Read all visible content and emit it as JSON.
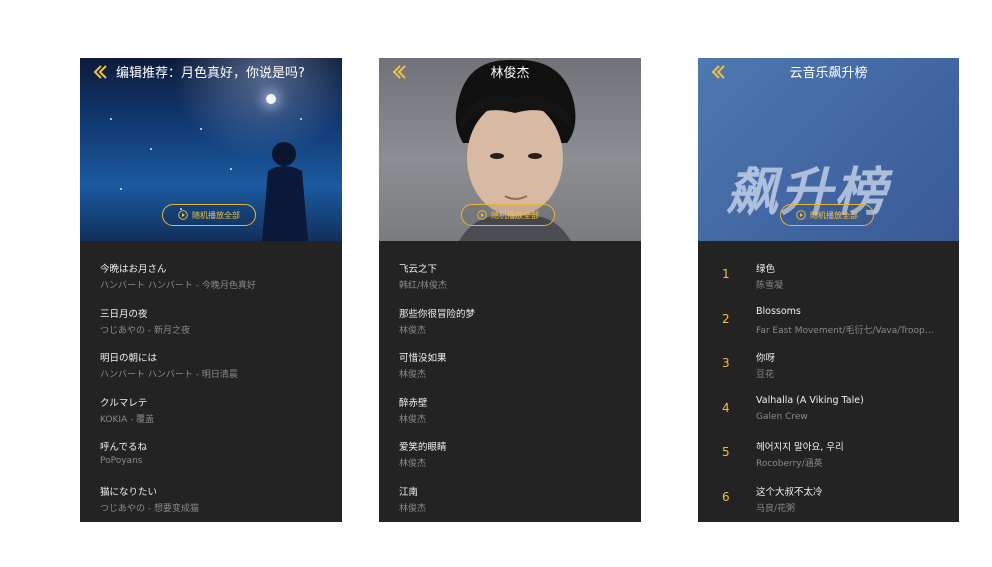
{
  "accent": "#f0c048",
  "playlist": {
    "title": "编辑推荐：月色真好，你说是吗?",
    "play_all": "随机播放全部",
    "songs": [
      {
        "name": "今晩はお月さん",
        "artist": "ハンバート ハンバート - 今晚月色真好"
      },
      {
        "name": "三日月の夜",
        "artist": "つじあやの - 新月之夜"
      },
      {
        "name": "明日の朝には",
        "artist": "ハンバート ハンバート - 明日清晨"
      },
      {
        "name": "クルマレテ",
        "artist": "KOKIA - 覆盖"
      },
      {
        "name": "呼んでるね",
        "artist": "PoPoyans"
      },
      {
        "name": "猫になりたい",
        "artist": "つじあやの - 想要变成猫"
      }
    ]
  },
  "singer": {
    "title": "林俊杰",
    "play_all": "随机播放全部",
    "songs": [
      {
        "name": "飞云之下",
        "artist": "韩红/林俊杰"
      },
      {
        "name": "那些你很冒险的梦",
        "artist": "林俊杰"
      },
      {
        "name": "可惜没如果",
        "artist": "林俊杰"
      },
      {
        "name": "醉赤壁",
        "artist": "林俊杰"
      },
      {
        "name": "爱笑的眼睛",
        "artist": "林俊杰"
      },
      {
        "name": "江南",
        "artist": "林俊杰"
      }
    ]
  },
  "chart": {
    "title": "云音乐飙升榜",
    "banner_text": "飙升榜",
    "play_all": "随机播放全部",
    "songs": [
      {
        "rank": "1",
        "name": "绿色",
        "artist": "陈雪凝"
      },
      {
        "rank": "2",
        "name": "Blossoms",
        "artist": "Far East Movement/毛衍七/Vava/Troop Brand"
      },
      {
        "rank": "3",
        "name": "你呀",
        "artist": "豆花"
      },
      {
        "rank": "4",
        "name": "Valhalla (A Viking Tale)",
        "artist": "Galen Crew"
      },
      {
        "rank": "5",
        "name": "헤어지지 말아요, 우리",
        "artist": "Rocoberry/涵英"
      },
      {
        "rank": "6",
        "name": "这个大叔不太冷",
        "artist": "马良/花粥"
      }
    ]
  }
}
